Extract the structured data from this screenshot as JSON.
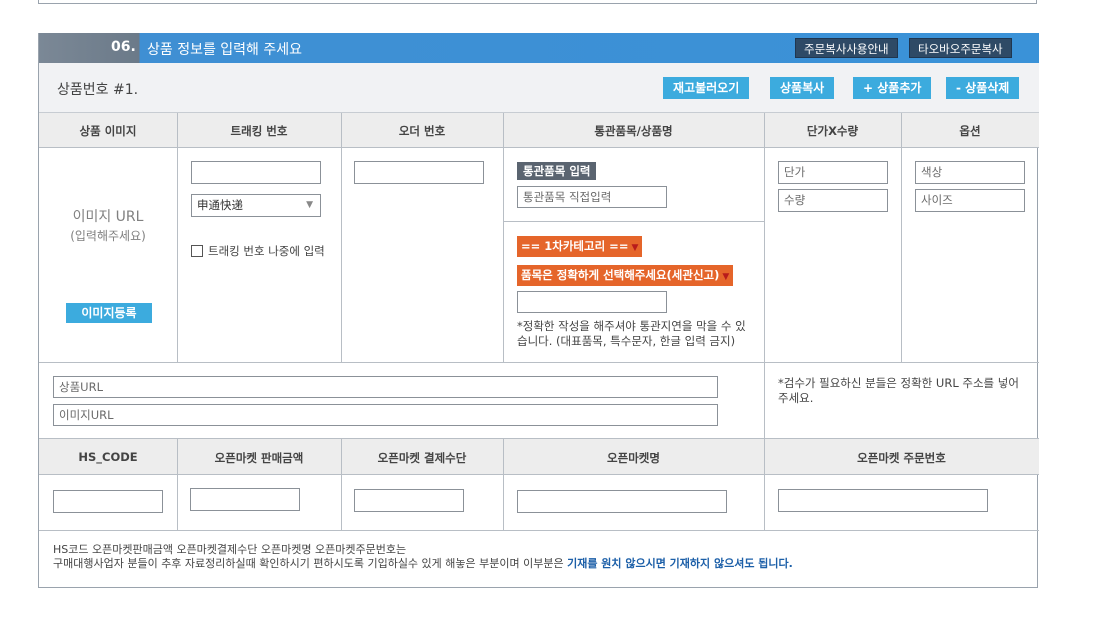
{
  "section": {
    "number": "06.",
    "title": "상품 정보를 입력해 주세요",
    "header_buttons": [
      "주문복사사용안내",
      "타오바오주문복사"
    ]
  },
  "product": {
    "number_label": "상품번호 #1.",
    "buttons": [
      "재고불러오기",
      "상품복사",
      "+ 상품추가",
      "- 상품삭제"
    ]
  },
  "table1": {
    "headers": [
      "상품 이미지",
      "트래킹 번호",
      "오더 번호",
      "통관품목/상품명",
      "단가X수량",
      "옵션"
    ]
  },
  "image_cell": {
    "url_label": "이미지 URL",
    "url_hint": "(입력해주세요)",
    "register_button": "이미지등록"
  },
  "tracking_cell": {
    "tracking_value": "",
    "courier_selected": "申通快递",
    "later_checkbox_label": "트래킹 번호 나중에 입력"
  },
  "order_cell": {
    "order_value": ""
  },
  "customs_cell": {
    "item_input_label": "통관품목 입력",
    "item_input_placeholder": "통관품목 직접입력",
    "category_select": "== 1차카테고리 ==",
    "item_select": "품목은 정확하게 선택해주세요(세관신고)",
    "item_name_value": "",
    "note_line1": "*정확한 작성을 해주셔야 통관지연을 막을 수 있",
    "note_line2": "습니다. (대표품목, 특수문자, 한글 입력 금지)"
  },
  "price_cell": {
    "price_placeholder": "단가",
    "qty_placeholder": "수량"
  },
  "option_cell": {
    "color_placeholder": "색상",
    "size_placeholder": "사이즈"
  },
  "url_row": {
    "product_url_placeholder": "상품URL",
    "image_url_placeholder": "이미지URL",
    "note_line1": "*검수가 필요하신 분들은 정확한 URL 주소를 넣어",
    "note_line2": "주세요."
  },
  "table2": {
    "headers": [
      "HS_CODE",
      "오픈마켓 판매금액",
      "오픈마켓 결제수단",
      "오픈마켓명",
      "오픈마켓 주문번호"
    ]
  },
  "footer_note": {
    "line1": "HS코드 오픈마켓판매금액 오픈마켓결제수단 오픈마켓명 오픈마켓주문번호는",
    "line2_prefix": "구매대행사업자 분들이 추후 자료정리하실때 확인하시기 편하시도록 기입하실수 있게 해놓은 부분이며 이부분은 ",
    "line2_emphasis": "기재를 원치 않으시면 기재하지 않으셔도 됩니다."
  },
  "colors": {
    "header_blue": "#3a92d8",
    "header_grey": "#6b7a89",
    "button_blue": "#3cabde",
    "dark_button": "#2e4a66",
    "orange_select": "#e5652a",
    "emphasis_blue": "#1c5fa8"
  }
}
